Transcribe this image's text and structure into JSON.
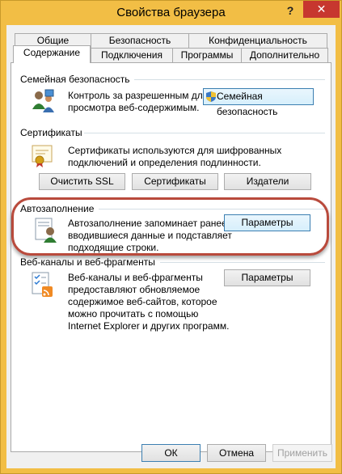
{
  "window": {
    "title": "Свойства браузера",
    "help": "?",
    "close": "✕"
  },
  "tabs": {
    "row1": [
      "Общие",
      "Безопасность",
      "Конфиденциальность"
    ],
    "row2": [
      "Содержание",
      "Подключения",
      "Программы",
      "Дополнительно"
    ],
    "active": "Содержание"
  },
  "family": {
    "title": "Семейная безопасность",
    "desc1": "Контроль за разрешенным для",
    "desc2": "просмотра веб-содержимым.",
    "button": "Семейная безопасность"
  },
  "certificates": {
    "title": "Сертификаты",
    "desc1": "Сертификаты используются для шифрованных",
    "desc2": "подключений и определения подлинности.",
    "buttons": [
      "Очистить SSL",
      "Сертификаты",
      "Издатели"
    ]
  },
  "autocomplete": {
    "title": "Автозаполнение",
    "desc1": "Автозаполнение запоминает ранее",
    "desc2": "вводившиеся данные и подставляет",
    "desc3": "подходящие строки.",
    "button": "Параметры"
  },
  "feeds": {
    "title": "Веб-каналы и веб-фрагменты",
    "desc1": "Веб-каналы и веб-фрагменты",
    "desc2": "предоставляют обновляемое",
    "desc3": "содержимое веб-сайтов, которое",
    "desc4": "можно прочитать с помощью",
    "desc5": "Internet Explorer и других программ.",
    "button": "Параметры"
  },
  "footer": {
    "ok": "ОК",
    "cancel": "Отмена",
    "apply": "Применить"
  },
  "colors": {
    "frame": "#f2be45",
    "close": "#c7372f",
    "highlight_ring": "#b94a3c"
  }
}
